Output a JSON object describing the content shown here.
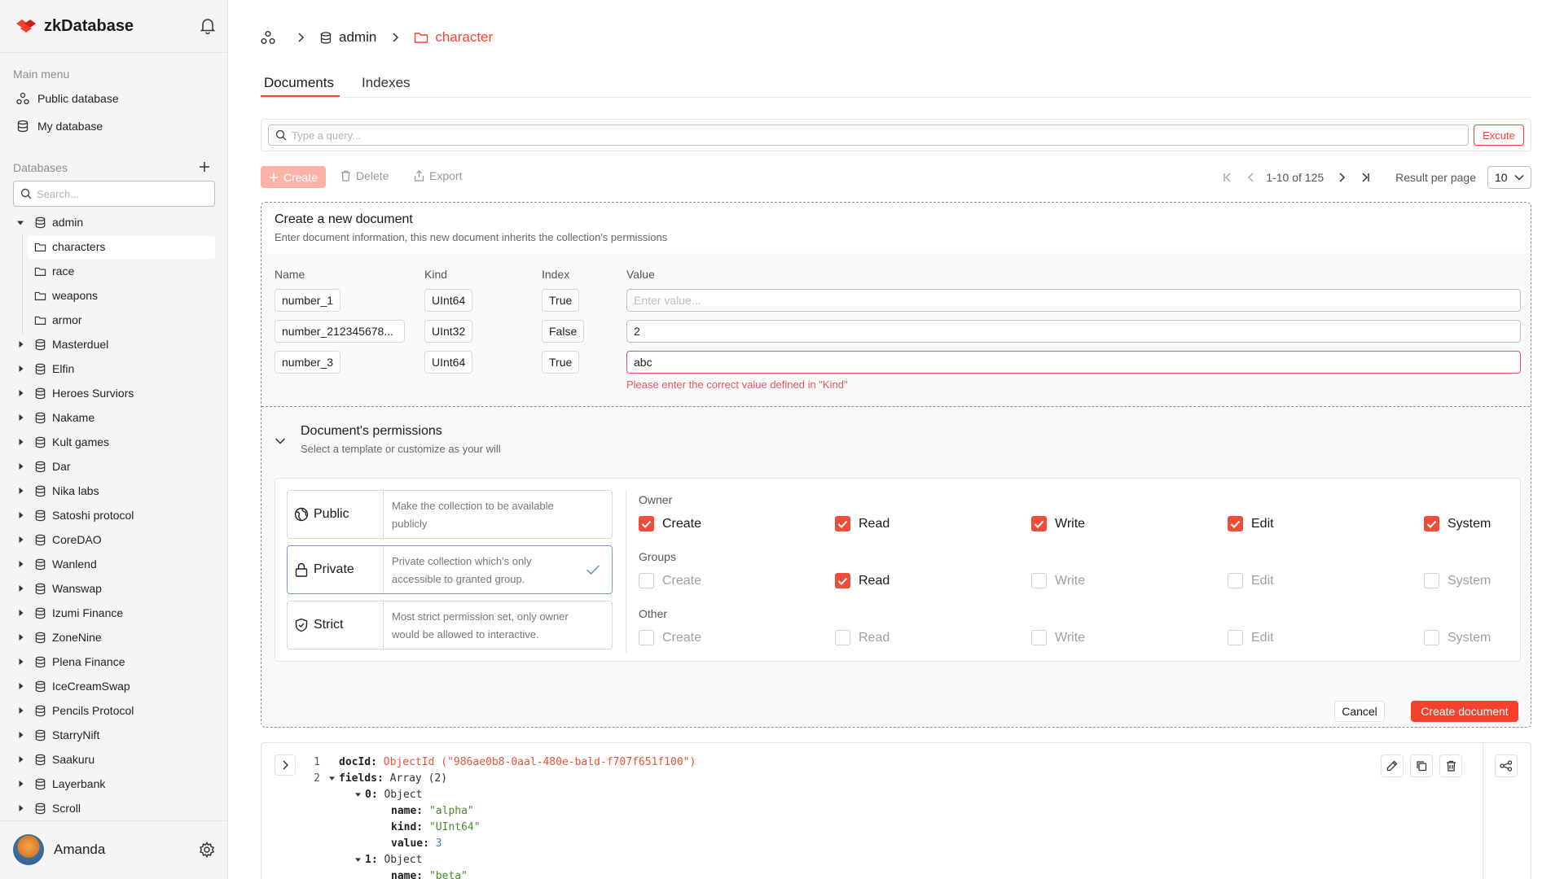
{
  "app": {
    "name": "zkDatabase"
  },
  "sidebar": {
    "main_menu_label": "Main menu",
    "menu": [
      {
        "label": "Public database",
        "icon": "share-nodes-icon"
      },
      {
        "label": "My database",
        "icon": "database-icon"
      }
    ],
    "databases_label": "Databases",
    "search_placeholder": "Search...",
    "tree": {
      "root": "admin",
      "children": [
        "characters",
        "race",
        "weapons",
        "armor"
      ],
      "active_child": "characters",
      "databases": [
        "Masterduel",
        "Elfin",
        "Heroes Surviors",
        "Nakame",
        "Kult games",
        "Dar",
        "Nika labs",
        "Satoshi protocol",
        "CoreDAO",
        "Wanlend",
        "Wanswap",
        "Izumi Finance",
        "ZoneNine",
        "Plena Finance",
        "IceCreamSwap",
        "Pencils Protocol",
        "StarryNift",
        "Saakuru",
        "Layerbank",
        "Scroll"
      ]
    },
    "user": {
      "name": "Amanda"
    }
  },
  "breadcrumb": {
    "db": "admin",
    "collection": "character"
  },
  "tabs": [
    {
      "label": "Documents",
      "active": true
    },
    {
      "label": "Indexes",
      "active": false
    }
  ],
  "query": {
    "placeholder": "Type a query...",
    "execute_label": "Excute"
  },
  "toolbar": {
    "create_label": "Create",
    "delete_label": "Delete",
    "export_label": "Export",
    "range": "1-10 of 125",
    "per_page_label": "Result per page",
    "per_page_value": "10"
  },
  "create_panel": {
    "title": "Create a new document",
    "subtitle": "Enter document information, this new document inherits the collection's permissions",
    "columns": {
      "name": "Name",
      "kind": "Kind",
      "index": "Index",
      "value": "Value"
    },
    "value_placeholder": "Enter value...",
    "rows": [
      {
        "name": "number_1",
        "kind": "UInt64",
        "index": "True",
        "value": ""
      },
      {
        "name": "number_212345678...",
        "kind": "UInt32",
        "index": "False",
        "value": "2"
      },
      {
        "name": "number_3",
        "kind": "UInt64",
        "index": "True",
        "value": "abc"
      }
    ],
    "error": "Please enter the correct value defined in \"Kind\"",
    "permissions": {
      "title": "Document's permissions",
      "subtitle": "Select a template or customize as your will",
      "templates": [
        {
          "name": "Public",
          "desc": "Make the collection to be available publicly",
          "selected": false,
          "icon": "public-icon"
        },
        {
          "name": "Private",
          "desc": "Private collection which's only accessible to granted group.",
          "selected": true,
          "icon": "lock-icon"
        },
        {
          "name": "Strict",
          "desc": "Most strict permission set, only owner would be allowed to interactive.",
          "selected": false,
          "icon": "shield-icon"
        }
      ],
      "columns": [
        "Create",
        "Read",
        "Write",
        "Edit",
        "System"
      ],
      "groups": [
        {
          "label": "Owner",
          "values": [
            true,
            true,
            true,
            true,
            true
          ]
        },
        {
          "label": "Groups",
          "values": [
            false,
            true,
            false,
            false,
            false
          ]
        },
        {
          "label": "Other",
          "values": [
            false,
            false,
            false,
            false,
            false
          ]
        }
      ]
    },
    "cancel_label": "Cancel",
    "submit_label": "Create document"
  },
  "document": {
    "lines": [
      {
        "n": "1",
        "indent": 0,
        "caret": false,
        "parts": [
          [
            "k",
            "docId: "
          ],
          [
            "r",
            "ObjectId (\"986ae0b8-0aal-480e-bald-f707f651f100\")"
          ]
        ]
      },
      {
        "n": "2",
        "indent": 0,
        "caret": true,
        "parts": [
          [
            "k",
            "fields: "
          ],
          [
            "t",
            "Array (2)"
          ]
        ]
      },
      {
        "n": "",
        "indent": 2,
        "caret": true,
        "parts": [
          [
            "k",
            "0: "
          ],
          [
            "t",
            "Object"
          ]
        ]
      },
      {
        "n": "",
        "indent": 4,
        "caret": false,
        "parts": [
          [
            "k",
            "name: "
          ],
          [
            "s",
            "\"alpha\""
          ]
        ]
      },
      {
        "n": "",
        "indent": 4,
        "caret": false,
        "parts": [
          [
            "k",
            "kind: "
          ],
          [
            "s",
            "\"UInt64\""
          ]
        ]
      },
      {
        "n": "",
        "indent": 4,
        "caret": false,
        "parts": [
          [
            "k",
            "value: "
          ],
          [
            "n",
            "3"
          ]
        ]
      },
      {
        "n": "",
        "indent": 2,
        "caret": true,
        "parts": [
          [
            "k",
            "1: "
          ],
          [
            "t",
            "Object"
          ]
        ]
      },
      {
        "n": "",
        "indent": 4,
        "caret": false,
        "parts": [
          [
            "k",
            "name: "
          ],
          [
            "s",
            "\"beta\""
          ]
        ]
      }
    ]
  },
  "colors": {
    "accent": "#f5412d",
    "error": "#e8536b",
    "checkbox": "#ee4d3c"
  }
}
